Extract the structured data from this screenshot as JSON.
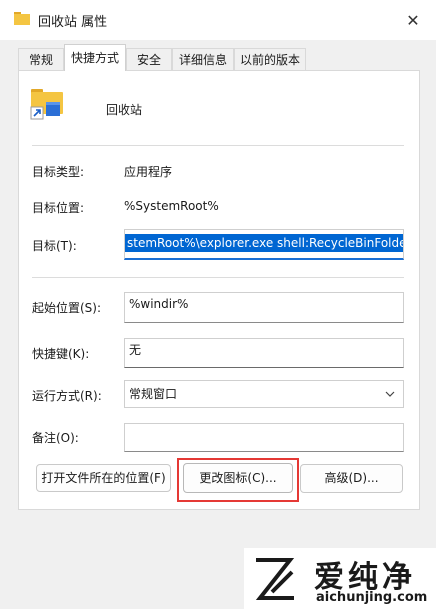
{
  "window": {
    "title": "回收站 属性"
  },
  "tabs": [
    {
      "label": "常规"
    },
    {
      "label": "快捷方式"
    },
    {
      "label": "安全"
    },
    {
      "label": "详细信息"
    },
    {
      "label": "以前的版本"
    }
  ],
  "header": {
    "name": "回收站"
  },
  "fields": {
    "target_type": {
      "label": "目标类型:",
      "value": "应用程序"
    },
    "target_location": {
      "label": "目标位置:",
      "value": "%SystemRoot%"
    },
    "target": {
      "label": "目标(T):",
      "value": "stemRoot%\\explorer.exe shell:RecycleBinFolder"
    },
    "start_in": {
      "label": "起始位置(S):",
      "value": "%windir%"
    },
    "shortcut_key": {
      "label": "快捷键(K):",
      "value": "无"
    },
    "run": {
      "label": "运行方式(R):",
      "value": "常规窗口"
    },
    "comment": {
      "label": "备注(O):",
      "value": ""
    }
  },
  "buttons": {
    "open_location": "打开文件所在的位置(F)",
    "change_icon": "更改图标(C)...",
    "advanced": "高级(D)..."
  },
  "watermark": {
    "name": "爱纯净",
    "url": "aichunjing.com"
  },
  "colors": {
    "accent": "#0066d2",
    "highlight_border": "#e53935",
    "folder": "#f4c542"
  }
}
